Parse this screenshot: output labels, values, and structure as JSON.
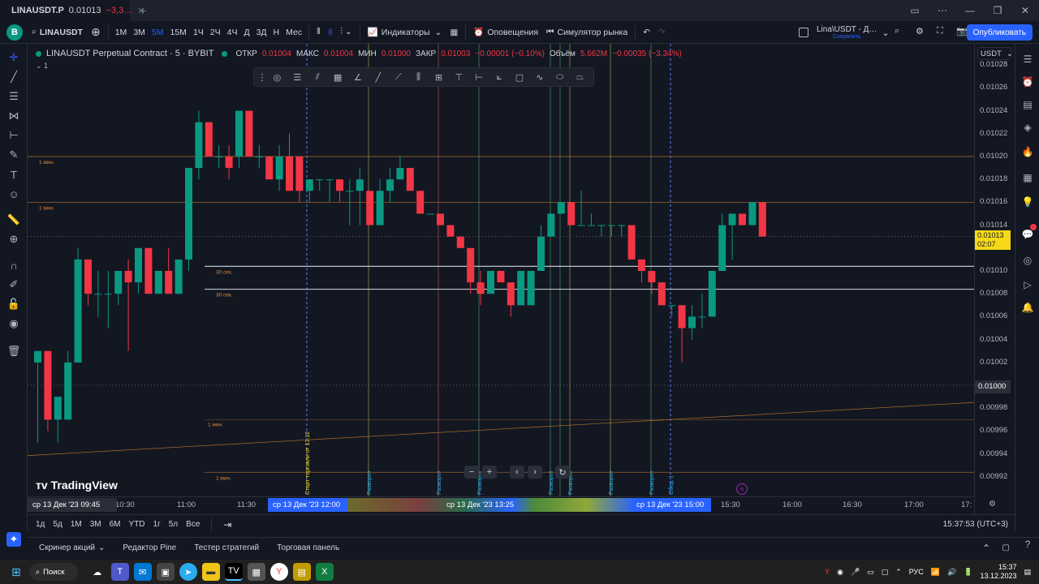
{
  "window": {
    "tab_title": "LINAUSDT.P",
    "tab_price": "0.01013",
    "tab_change": "−3,3…",
    "new_tab": "+"
  },
  "topbar": {
    "avatar": "B",
    "symbol": "LINAUSDT",
    "intervals": [
      "1М",
      "3М",
      "5М",
      "15М",
      "1Ч",
      "2Ч",
      "4Ч",
      "Д",
      "3Д",
      "Н",
      "Мес"
    ],
    "active_interval": "5М",
    "indicators": "Индикаторы",
    "alerts": "Оповещения",
    "simulator": "Симулятор рынка",
    "layout_name": "Lina\\USDT - Д…",
    "layout_saved": "Сохранить",
    "publish": "Опубликовать"
  },
  "legend": {
    "title": "LINAUSDT Perpetual Contract · 5 · BYBIT",
    "o_label": "ОТКР",
    "o": "0.01004",
    "h_label": "МАКС",
    "h": "0.01004",
    "l_label": "МИН",
    "l": "0.01000",
    "c_label": "ЗАКР",
    "c": "0.01003",
    "chg": "−0.00001 (−0.10%)",
    "vol_label": "Объём",
    "vol": "5.662M",
    "vol_chg": "−0.00035 (−3.34%)",
    "collapse": "1"
  },
  "price_axis": {
    "currency": "USDT",
    "labels": [
      "0.01028",
      "0.01026",
      "0.01024",
      "0.01022",
      "0.01020",
      "0.01018",
      "0.01016",
      "0.01014",
      "0.01010",
      "0.01008",
      "0.01006",
      "0.01004",
      "0.01002",
      "0.01000",
      "0.00998",
      "0.00996",
      "0.00994",
      "0.00992"
    ],
    "current_price": "0.01013",
    "countdown": "02:07"
  },
  "chart_data": {
    "type": "candlestick",
    "ylim": [
      0.00991,
      0.01029
    ],
    "candles": [
      {
        "o": 0.01002,
        "h": 0.01003,
        "l": 0.00995,
        "c": 0.01003
      },
      {
        "o": 0.01003,
        "h": 0.01003,
        "l": 0.00996,
        "c": 0.00997
      },
      {
        "o": 0.00997,
        "h": 0.00998,
        "l": 0.00995,
        "c": 0.00999
      },
      {
        "o": 0.00997,
        "h": 0.01003,
        "l": 0.00997,
        "c": 0.01002
      },
      {
        "o": 0.01002,
        "h": 0.01012,
        "l": 0.01002,
        "c": 0.01011
      },
      {
        "o": 0.01011,
        "h": 0.01011,
        "l": 0.01007,
        "c": 0.01008
      },
      {
        "o": 0.01008,
        "h": 0.0101,
        "l": 0.01006,
        "c": 0.01008
      },
      {
        "o": 0.01008,
        "h": 0.0101,
        "l": 0.01005,
        "c": 0.01008
      },
      {
        "o": 0.01008,
        "h": 0.0101,
        "l": 0.01007,
        "c": 0.0101
      },
      {
        "o": 0.0101,
        "h": 0.01011,
        "l": 0.01003,
        "c": 0.01009
      },
      {
        "o": 0.01009,
        "h": 0.01012,
        "l": 0.01008,
        "c": 0.01012
      },
      {
        "o": 0.01012,
        "h": 0.01012,
        "l": 0.01008,
        "c": 0.01008
      },
      {
        "o": 0.01008,
        "h": 0.0101,
        "l": 0.01008,
        "c": 0.0101
      },
      {
        "o": 0.0101,
        "h": 0.01012,
        "l": 0.01008,
        "c": 0.01008
      },
      {
        "o": 0.01008,
        "h": 0.01011,
        "l": 0.01008,
        "c": 0.01011
      },
      {
        "o": 0.01011,
        "h": 0.01019,
        "l": 0.0101,
        "c": 0.01019
      },
      {
        "o": 0.01019,
        "h": 0.01024,
        "l": 0.01018,
        "c": 0.01023
      },
      {
        "o": 0.01023,
        "h": 0.01023,
        "l": 0.0102,
        "c": 0.0102
      },
      {
        "o": 0.0102,
        "h": 0.01021,
        "l": 0.01019,
        "c": 0.0102
      },
      {
        "o": 0.0102,
        "h": 0.01021,
        "l": 0.01018,
        "c": 0.01019
      },
      {
        "o": 0.0102,
        "h": 0.01024,
        "l": 0.01019,
        "c": 0.01024
      },
      {
        "o": 0.01024,
        "h": 0.01024,
        "l": 0.0102,
        "c": 0.0102
      },
      {
        "o": 0.0102,
        "h": 0.01021,
        "l": 0.01019,
        "c": 0.0102
      },
      {
        "o": 0.0102,
        "h": 0.0102,
        "l": 0.01018,
        "c": 0.01018
      },
      {
        "o": 0.01018,
        "h": 0.01021,
        "l": 0.01017,
        "c": 0.0102
      },
      {
        "o": 0.0102,
        "h": 0.01022,
        "l": 0.01017,
        "c": 0.01017
      },
      {
        "o": 0.0102,
        "h": 0.0102,
        "l": 0.01016,
        "c": 0.01017
      },
      {
        "o": 0.01017,
        "h": 0.01018,
        "l": 0.01016,
        "c": 0.01018
      },
      {
        "o": 0.01018,
        "h": 0.01018,
        "l": 0.01017,
        "c": 0.01018
      },
      {
        "o": 0.01018,
        "h": 0.01018,
        "l": 0.01016,
        "c": 0.01018
      },
      {
        "o": 0.01018,
        "h": 0.01018,
        "l": 0.01016,
        "c": 0.01017
      },
      {
        "o": 0.01017,
        "h": 0.01018,
        "l": 0.01014,
        "c": 0.01017
      },
      {
        "o": 0.01017,
        "h": 0.01019,
        "l": 0.01014,
        "c": 0.01018
      },
      {
        "o": 0.01017,
        "h": 0.01017,
        "l": 0.01014,
        "c": 0.01014
      },
      {
        "o": 0.01014,
        "h": 0.01018,
        "l": 0.01014,
        "c": 0.01017
      },
      {
        "o": 0.01017,
        "h": 0.01019,
        "l": 0.01016,
        "c": 0.01018
      },
      {
        "o": 0.01018,
        "h": 0.0102,
        "l": 0.01018,
        "c": 0.01019
      },
      {
        "o": 0.01019,
        "h": 0.01019,
        "l": 0.01017,
        "c": 0.01017
      },
      {
        "o": 0.01017,
        "h": 0.01017,
        "l": 0.01015,
        "c": 0.01015
      },
      {
        "o": 0.01015,
        "h": 0.01015,
        "l": 0.01015,
        "c": 0.01015
      },
      {
        "o": 0.01015,
        "h": 0.01015,
        "l": 0.01014,
        "c": 0.01014
      },
      {
        "o": 0.01014,
        "h": 0.01014,
        "l": 0.01013,
        "c": 0.01013
      },
      {
        "o": 0.01013,
        "h": 0.01013,
        "l": 0.01012,
        "c": 0.01012
      },
      {
        "o": 0.01012,
        "h": 0.01012,
        "l": 0.01008,
        "c": 0.01009
      },
      {
        "o": 0.01009,
        "h": 0.0101,
        "l": 0.01007,
        "c": 0.01008
      },
      {
        "o": 0.01008,
        "h": 0.0101,
        "l": 0.01008,
        "c": 0.0101
      },
      {
        "o": 0.0101,
        "h": 0.0101,
        "l": 0.01009,
        "c": 0.01009
      },
      {
        "o": 0.01009,
        "h": 0.01009,
        "l": 0.01006,
        "c": 0.01007
      },
      {
        "o": 0.01007,
        "h": 0.0101,
        "l": 0.01007,
        "c": 0.0101
      },
      {
        "o": 0.01007,
        "h": 0.0101,
        "l": 0.01007,
        "c": 0.0101
      },
      {
        "o": 0.0101,
        "h": 0.01014,
        "l": 0.0101,
        "c": 0.01013
      },
      {
        "o": 0.01013,
        "h": 0.01015,
        "l": 0.01013,
        "c": 0.01015
      },
      {
        "o": 0.01015,
        "h": 0.01016,
        "l": 0.01015,
        "c": 0.01016
      },
      {
        "o": 0.01016,
        "h": 0.01016,
        "l": 0.01014,
        "c": 0.01014
      },
      {
        "o": 0.01014,
        "h": 0.01017,
        "l": 0.01014,
        "c": 0.01014
      },
      {
        "o": 0.01014,
        "h": 0.01015,
        "l": 0.01014,
        "c": 0.01014
      },
      {
        "o": 0.01014,
        "h": 0.01014,
        "l": 0.01013,
        "c": 0.01014
      },
      {
        "o": 0.01014,
        "h": 0.01014,
        "l": 0.01013,
        "c": 0.01014
      },
      {
        "o": 0.01014,
        "h": 0.01014,
        "l": 0.01013,
        "c": 0.01014
      },
      {
        "o": 0.01014,
        "h": 0.01014,
        "l": 0.01011,
        "c": 0.01011
      },
      {
        "o": 0.01011,
        "h": 0.01011,
        "l": 0.01009,
        "c": 0.0101
      },
      {
        "o": 0.0101,
        "h": 0.0101,
        "l": 0.01008,
        "c": 0.01009
      },
      {
        "o": 0.01009,
        "h": 0.01009,
        "l": 0.01007,
        "c": 0.01007
      },
      {
        "o": 0.01007,
        "h": 0.01007,
        "l": 0.01006,
        "c": 0.01007
      },
      {
        "o": 0.01007,
        "h": 0.01007,
        "l": 0.01002,
        "c": 0.01005
      },
      {
        "o": 0.01005,
        "h": 0.01007,
        "l": 0.01004,
        "c": 0.01006
      },
      {
        "o": 0.01006,
        "h": 0.01008,
        "l": 0.01005,
        "c": 0.01006
      },
      {
        "o": 0.01006,
        "h": 0.0101,
        "l": 0.01006,
        "c": 0.0101
      },
      {
        "o": 0.0101,
        "h": 0.01015,
        "l": 0.0101,
        "c": 0.01014
      },
      {
        "o": 0.01014,
        "h": 0.01015,
        "l": 0.01011,
        "c": 0.01015
      },
      {
        "o": 0.01015,
        "h": 0.01015,
        "l": 0.01014,
        "c": 0.01014
      },
      {
        "o": 0.01014,
        "h": 0.01016,
        "l": 0.01014,
        "c": 0.01016
      },
      {
        "o": 0.01016,
        "h": 0.01016,
        "l": 0.01013,
        "c": 0.01013
      }
    ],
    "horizontal_lines": [
      {
        "price": 0.0102,
        "label": "1 мин.",
        "color": "#b8762c"
      },
      {
        "price": 0.01016,
        "label": "1 мин.",
        "color": "#b8762c"
      },
      {
        "price": 0.010104,
        "label": "30 сек.",
        "color": "#d1d4dc"
      },
      {
        "price": 0.010084,
        "label": "30 сек.",
        "color": "#d1d4dc"
      },
      {
        "price": 0.009924,
        "label": "1 мин.",
        "color": "#b8762c"
      }
    ],
    "vertical_labels": [
      "Старт торговли от 13.12",
      "Разворот",
      "Разворот",
      "Разворот",
      "Разворот",
      "Разворот",
      "Разворот",
      "Разворот",
      "Обед :)"
    ],
    "colors": {
      "up": "#089981",
      "down": "#f23645",
      "background": "#131722"
    }
  },
  "time_axis": {
    "labels": [
      "10:30",
      "11:00",
      "11:30",
      "15:30",
      "16:00",
      "16:30",
      "17:00",
      "17:"
    ],
    "cursor_left": "ср 13 Дек '23   09:45",
    "pill_start": "ср 13 Дек '23   12:00",
    "pill_end": "ср 13 Дек '23   15:00",
    "pill_overlap": "ср 13 Дек '23   13:25"
  },
  "range_bar": {
    "ranges": [
      "1д",
      "5д",
      "1М",
      "3М",
      "6М",
      "YTD",
      "1г",
      "5л",
      "Все"
    ],
    "clock": "15:37:53 (UTC+3)"
  },
  "panel_bar": {
    "items": [
      "Скринер акций",
      "Редактор Pine",
      "Тестер стратегий",
      "Торговая панель"
    ]
  },
  "taskbar": {
    "search": "Поиск",
    "lang": "РУС",
    "time": "15:37",
    "date": "13.12.2023"
  },
  "logo": "TradingView"
}
